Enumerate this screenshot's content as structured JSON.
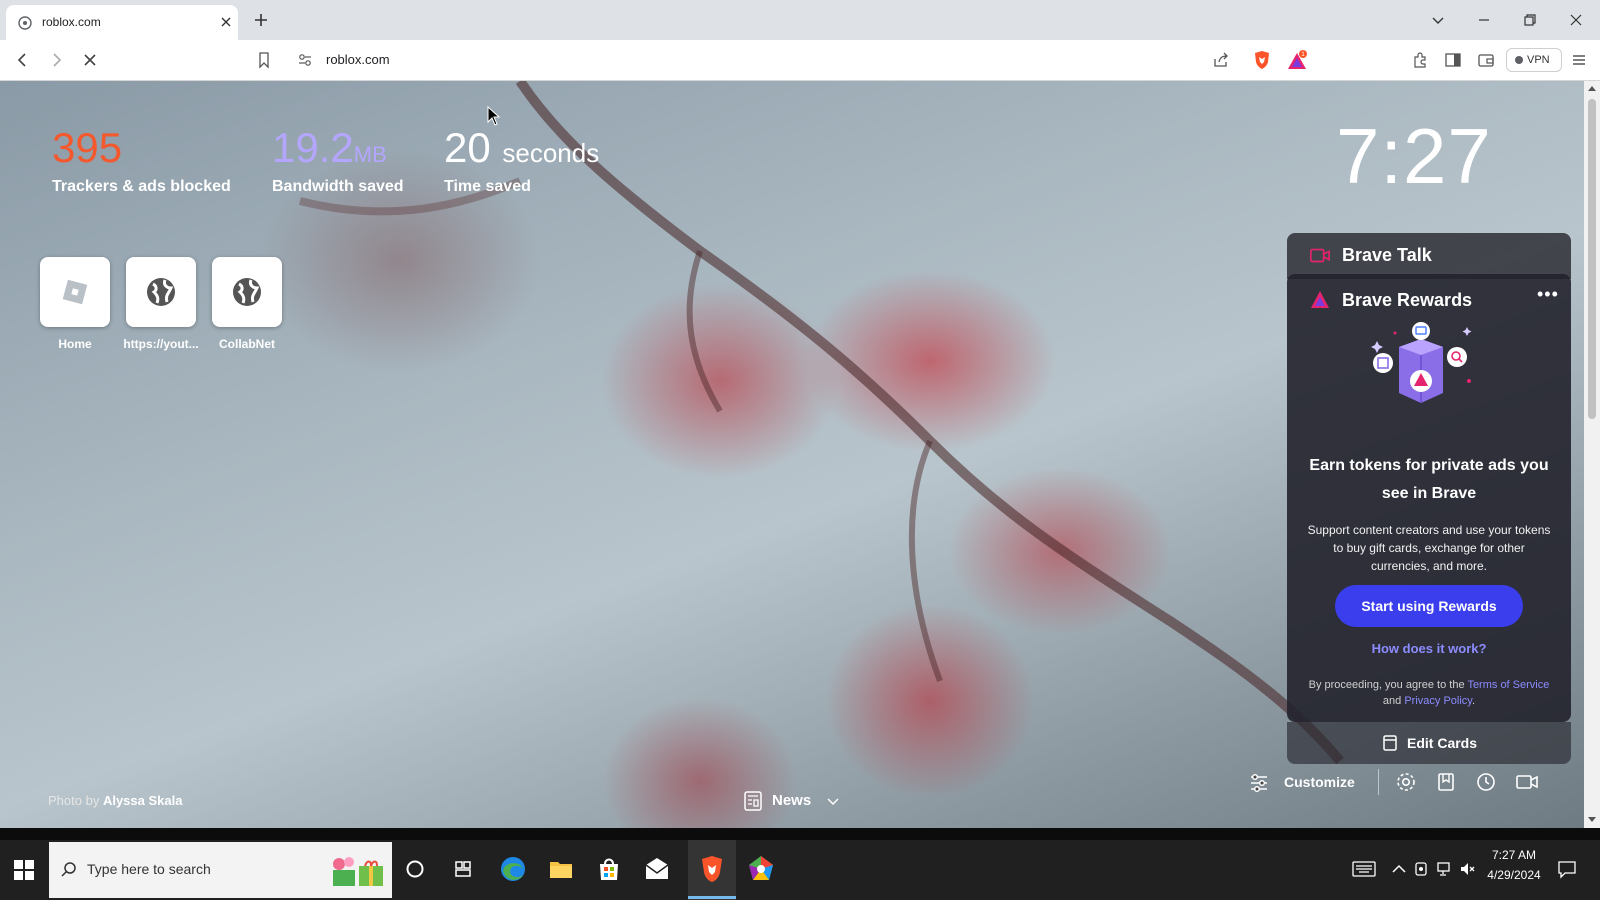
{
  "browser": {
    "tab": {
      "title": "roblox.com",
      "favicon": "site-settings-icon"
    },
    "address_bar": {
      "url": "roblox.com"
    },
    "vpn_label": "VPN",
    "rewards_badge_count": "1"
  },
  "stats": {
    "trackers": {
      "value": "395",
      "label": "Trackers & ads blocked",
      "color": "#f4582d"
    },
    "bandwidth": {
      "value": "19.2",
      "unit": "MB",
      "label": "Bandwidth saved",
      "color": "#b4a6ff"
    },
    "time": {
      "value": "20",
      "unit": "seconds",
      "label": "Time saved",
      "color": "#ffffff"
    }
  },
  "clock": "7:27",
  "top_sites": [
    {
      "label": "Home",
      "icon": "roblox-icon"
    },
    {
      "label": "https://yout...",
      "icon": "globe-icon"
    },
    {
      "label": "CollabNet",
      "icon": "globe-icon"
    }
  ],
  "photo_credit": {
    "prefix": "Photo by",
    "author": "Alyssa Skala"
  },
  "news": {
    "label": "News"
  },
  "customize": {
    "label": "Customize"
  },
  "cards": {
    "talk": {
      "title": "Brave Talk"
    },
    "rewards": {
      "title": "Brave Rewards",
      "more": "•••",
      "headline": "Earn tokens for private ads you see in Brave",
      "body": "Support content creators and use your tokens to buy gift cards, exchange for other currencies, and more.",
      "cta": "Start using Rewards",
      "link": "How does it work?",
      "legal_prefix": "By proceeding, you agree to the",
      "legal_terms": "Terms of Service",
      "legal_and": "and",
      "legal_privacy": "Privacy Policy",
      "legal_end": "."
    },
    "edit": {
      "label": "Edit Cards"
    }
  },
  "taskbar": {
    "search_placeholder": "Type here to search",
    "time": "7:27 AM",
    "date": "4/29/2024"
  },
  "colors": {
    "brave_orange": "#fb542b",
    "rewards_button": "#3b3eed",
    "link": "#8c8cff"
  }
}
